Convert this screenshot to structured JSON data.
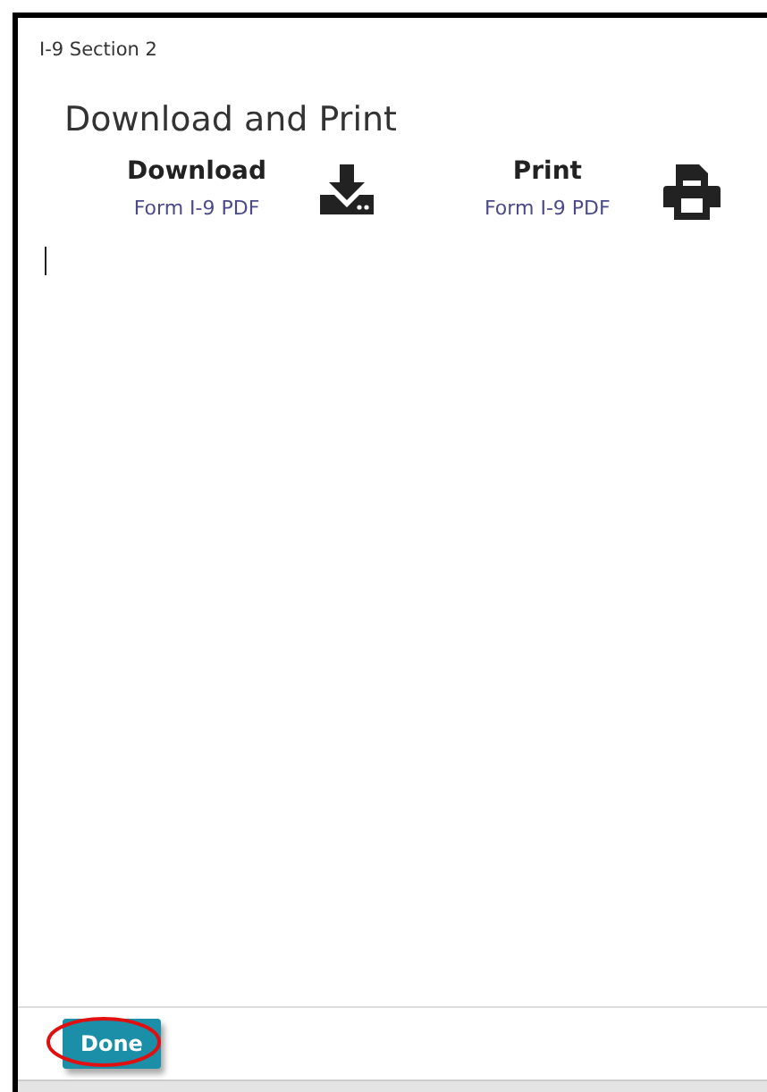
{
  "dialog": {
    "breadcrumb": "I-9 Section 2",
    "title": "Download and Print"
  },
  "actions": [
    {
      "kind": "download",
      "label": "Download",
      "sublabel": "Form I-9 PDF"
    },
    {
      "kind": "print",
      "label": "Print",
      "sublabel": "Form I-9 PDF"
    }
  ],
  "footer": {
    "button": "Done"
  }
}
